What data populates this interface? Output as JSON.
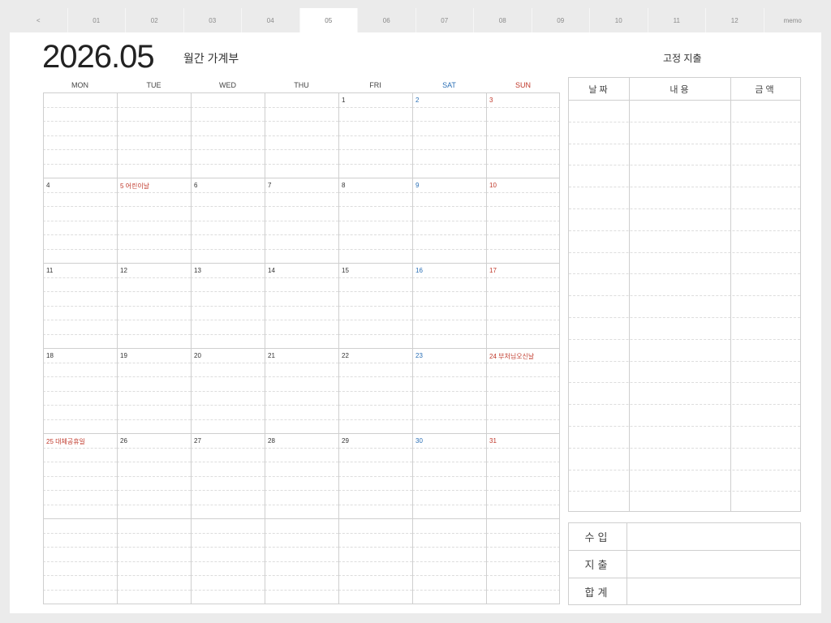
{
  "tabs": [
    "<",
    "01",
    "02",
    "03",
    "04",
    "05",
    "06",
    "07",
    "08",
    "09",
    "10",
    "11",
    "12",
    "memo"
  ],
  "active_tab": "05",
  "header": {
    "year_month": "2026.05",
    "subtitle": "월간 가계부",
    "fixed_title": "고정 지출"
  },
  "weekdays": [
    "MON",
    "TUE",
    "WED",
    "THU",
    "FRI",
    "SAT",
    "SUN"
  ],
  "weeks": [
    [
      {
        "label": ""
      },
      {
        "label": ""
      },
      {
        "label": ""
      },
      {
        "label": ""
      },
      {
        "label": "1"
      },
      {
        "label": "2",
        "type": "sat"
      },
      {
        "label": "3",
        "type": "red"
      }
    ],
    [
      {
        "label": "4"
      },
      {
        "label": "5 어린이날",
        "type": "red"
      },
      {
        "label": "6"
      },
      {
        "label": "7"
      },
      {
        "label": "8"
      },
      {
        "label": "9",
        "type": "sat"
      },
      {
        "label": "10",
        "type": "red"
      }
    ],
    [
      {
        "label": "11"
      },
      {
        "label": "12"
      },
      {
        "label": "13"
      },
      {
        "label": "14"
      },
      {
        "label": "15"
      },
      {
        "label": "16",
        "type": "sat"
      },
      {
        "label": "17",
        "type": "red"
      }
    ],
    [
      {
        "label": "18"
      },
      {
        "label": "19"
      },
      {
        "label": "20"
      },
      {
        "label": "21"
      },
      {
        "label": "22"
      },
      {
        "label": "23",
        "type": "sat"
      },
      {
        "label": "24 부처님오신날",
        "type": "red"
      }
    ],
    [
      {
        "label": "25 대체공휴일",
        "type": "red"
      },
      {
        "label": "26"
      },
      {
        "label": "27"
      },
      {
        "label": "28"
      },
      {
        "label": "29"
      },
      {
        "label": "30",
        "type": "sat"
      },
      {
        "label": "31",
        "type": "red"
      }
    ],
    [
      {
        "label": ""
      },
      {
        "label": ""
      },
      {
        "label": ""
      },
      {
        "label": ""
      },
      {
        "label": ""
      },
      {
        "label": ""
      },
      {
        "label": ""
      }
    ]
  ],
  "fixed_table": {
    "headers": [
      "날짜",
      "내용",
      "금액"
    ]
  },
  "summary": {
    "rows": [
      "수입",
      "지출",
      "합계"
    ]
  },
  "colors": {
    "saturday": "#2a6fb5",
    "sunday_holiday": "#c0392b",
    "grid": "#cfcfcf",
    "background": "#ebebeb"
  }
}
